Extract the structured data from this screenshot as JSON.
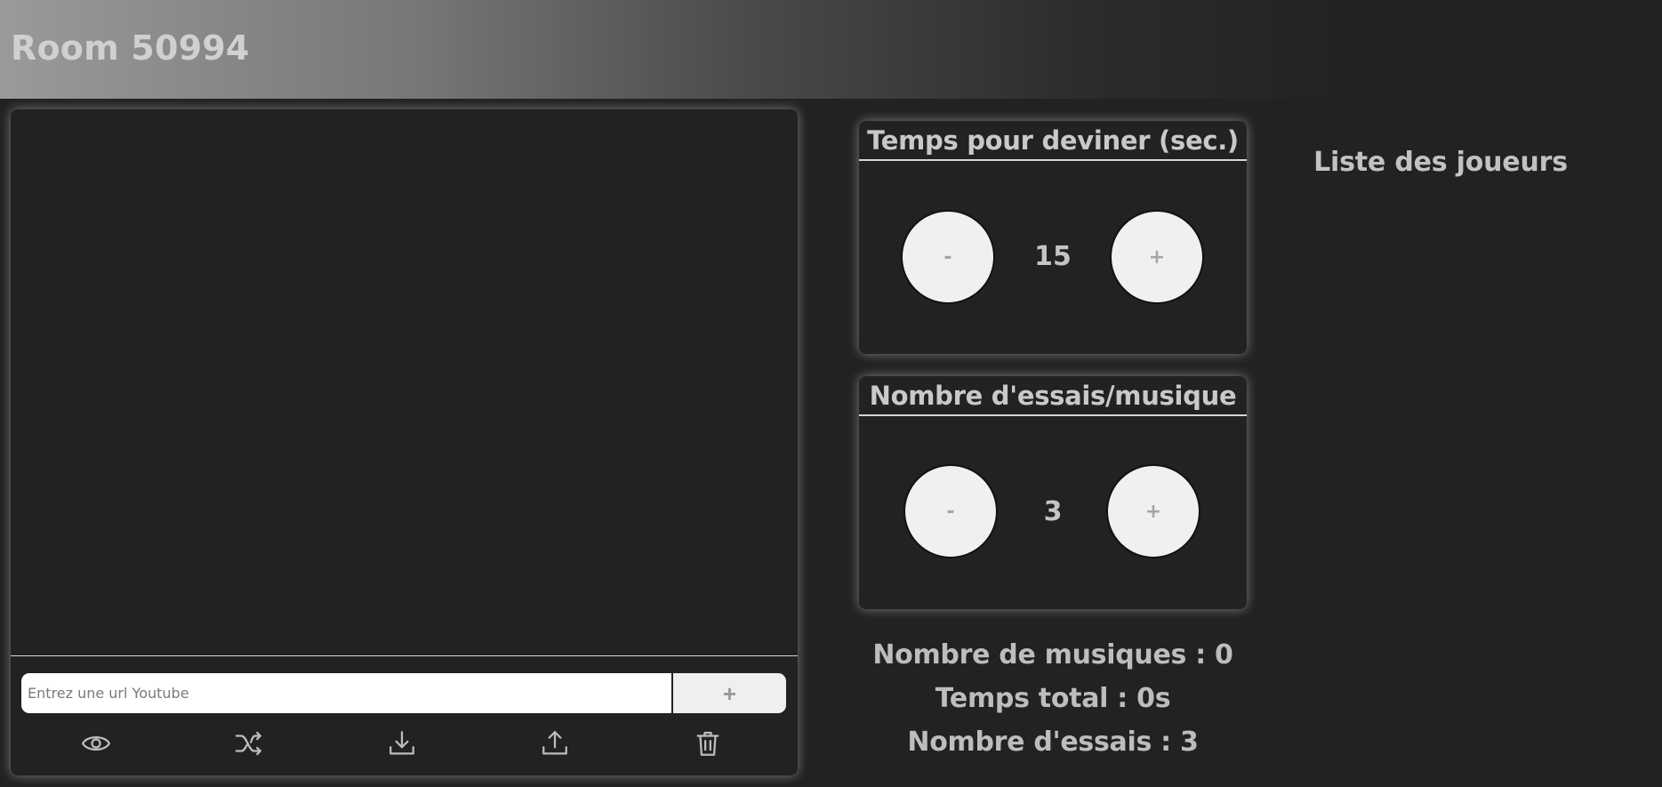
{
  "header": {
    "title": "Room 50994"
  },
  "playlist": {
    "url_placeholder": "Entrez une url Youtube",
    "url_value": "",
    "add_label": "+",
    "toolbar": [
      "eye-icon",
      "shuffle-icon",
      "download-icon",
      "upload-icon",
      "trash-icon"
    ]
  },
  "guess_time": {
    "title": "Temps pour deviner (sec.)",
    "minus_label": "-",
    "value": "15",
    "plus_label": "+"
  },
  "tries": {
    "title": "Nombre d'essais/musique",
    "minus_label": "-",
    "value": "3",
    "plus_label": "+"
  },
  "stats": {
    "music_count": "Nombre de musiques : 0",
    "total_time": "Temps total : 0s",
    "tries_count": "Nombre d'essais : 3"
  },
  "players": {
    "title": "Liste des joueurs"
  },
  "colors": {
    "background": "#222222",
    "button": "#f0f0f0",
    "text": "#bdbdbd"
  }
}
